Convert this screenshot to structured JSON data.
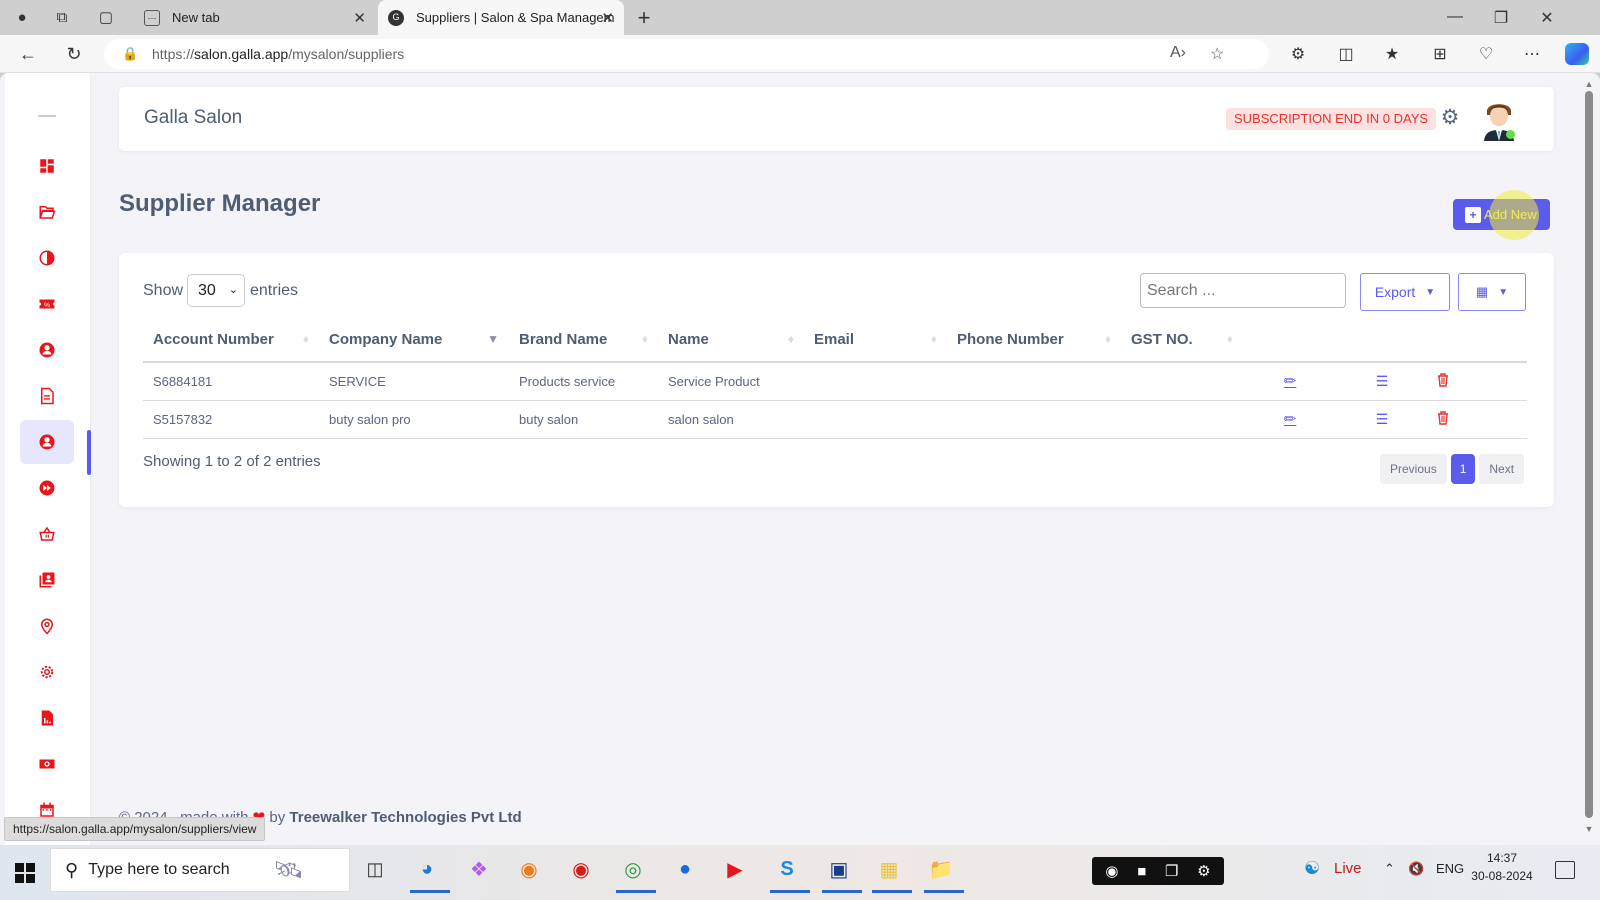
{
  "browser": {
    "tabs": [
      {
        "label": "New tab",
        "active": false
      },
      {
        "label": "Suppliers | Salon & Spa Managem",
        "active": true
      }
    ],
    "new_tab_symbol": "+",
    "url_prefix": "https://",
    "url_host": "salon.galla.app",
    "url_path": "/mysalon/suppliers",
    "status_url": "https://salon.galla.app/mysalon/suppliers/view"
  },
  "header": {
    "brand": "Galla Salon",
    "subscription_badge": "SUBSCRIPTION END IN 0 DAYS",
    "user_status": "online"
  },
  "sidebar": {
    "items": [
      {
        "icon": "dashboard-icon"
      },
      {
        "icon": "folder-open-icon"
      },
      {
        "icon": "contrast-icon"
      },
      {
        "icon": "ticket-percent-icon"
      },
      {
        "icon": "user-circle-icon"
      },
      {
        "icon": "document-icon"
      },
      {
        "icon": "supplier-user-icon",
        "active": true
      },
      {
        "icon": "fast-forward-icon"
      },
      {
        "icon": "basket-icon"
      },
      {
        "icon": "contact-book-icon"
      },
      {
        "icon": "location-pin-icon"
      },
      {
        "icon": "settings-icon"
      },
      {
        "icon": "report-chart-icon"
      },
      {
        "icon": "cash-icon"
      },
      {
        "icon": "calendar-icon"
      }
    ]
  },
  "page": {
    "title": "Supplier Manager",
    "add_new_label": "Add New"
  },
  "table_controls": {
    "show_label": "Show",
    "entries_value": "30",
    "entries_label": "entries",
    "search_placeholder": "Search ...",
    "export_label": "Export"
  },
  "table": {
    "columns": [
      "Account Number",
      "Company Name",
      "Brand Name",
      "Name",
      "Email",
      "Phone Number",
      "GST NO."
    ],
    "rows": [
      {
        "account_number": "S6884181",
        "company_name": "SERVICE",
        "brand_name": "Products service",
        "name": "Service Product",
        "email": "",
        "phone": "",
        "gst": ""
      },
      {
        "account_number": "S5157832",
        "company_name": "buty salon pro",
        "brand_name": "buty salon",
        "name": "salon salon",
        "email": "",
        "phone": "",
        "gst": ""
      }
    ],
    "info": "Showing 1 to 2 of 2 entries",
    "pagination": {
      "previous": "Previous",
      "current": "1",
      "next": "Next"
    }
  },
  "footer": {
    "prefix": "© 2024 , made with",
    "by": "by",
    "company": "Treewalker Technologies Pvt Ltd"
  },
  "taskbar": {
    "search_placeholder": "Type here to search",
    "weather_label": "Live",
    "language": "ENG",
    "time": "14:37",
    "date": "30-08-2024"
  },
  "colors": {
    "accent": "#5b5bec",
    "sidebar_icon": "#e8161c",
    "badge_bg": "#fde0e0",
    "badge_text": "#e8342c"
  }
}
